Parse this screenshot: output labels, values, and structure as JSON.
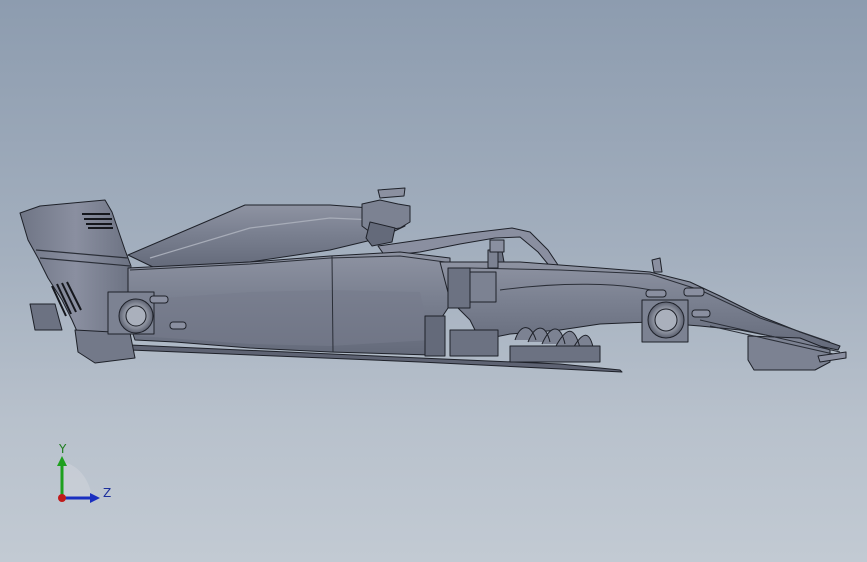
{
  "viewport": {
    "background_top": "#8d9caf",
    "background_bottom": "#c2cad3",
    "model_fill": "#7c8292",
    "model_dark": "#5e6373",
    "model_light": "#a4a9b6",
    "edge_color": "#1e2129"
  },
  "triad": {
    "y_label": "Y",
    "z_label": "Z",
    "y_color": "#1ea01e",
    "z_color": "#1a2fc0",
    "x_color": "#c01a1a"
  }
}
